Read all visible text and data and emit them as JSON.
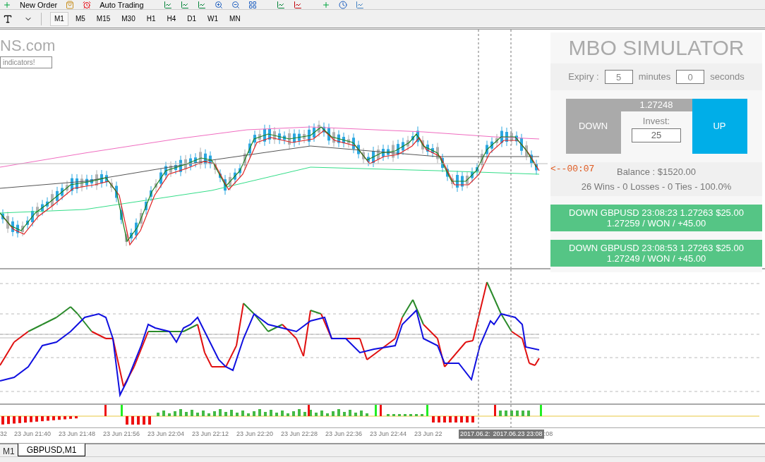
{
  "toolbar": {
    "buttons": [
      {
        "label": "New Order"
      },
      {
        "label": "Auto Trading"
      }
    ]
  },
  "timeframes": [
    {
      "label": "M1",
      "selected": true
    },
    {
      "label": "M5",
      "selected": false
    },
    {
      "label": "M15",
      "selected": false
    },
    {
      "label": "M30",
      "selected": false
    },
    {
      "label": "H1",
      "selected": false
    },
    {
      "label": "H4",
      "selected": false
    },
    {
      "label": "D1",
      "selected": false
    },
    {
      "label": "W1",
      "selected": false
    },
    {
      "label": "MN",
      "selected": false
    }
  ],
  "chart": {
    "watermark": "NS.com",
    "note": "indicators!",
    "timer": "<--00:07",
    "time_axis": [
      "32",
      "23 Jun 21:40",
      "23 Jun 21:48",
      "23 Jun 21:56",
      "23 Jun 22:04",
      "23 Jun 22:12",
      "23 Jun 22:20",
      "23 Jun 22:28",
      "23 Jun 22:36",
      "23 Jun 22:44",
      "23 Jun 22"
    ],
    "time_markers": [
      "2017.06.2:",
      "2017.06.23 23:08"
    ],
    "time_axis_tail": ":08"
  },
  "simulator": {
    "title": "MBO SIMULATOR",
    "expiry_label": "Expiry :",
    "expiry_minutes": "5",
    "minutes_label": "minutes",
    "expiry_seconds": "0",
    "seconds_label": "seconds",
    "down_label": "DOWN",
    "price": "1.27248",
    "invest_label": "Invest:",
    "invest_value": "25",
    "up_label": "UP",
    "balance": "Balance : $1520.00",
    "stats": "26 Wins - 0 Losses - 0 Ties - 100.0%",
    "trades": [
      {
        "line1": "DOWN GBPUSD 23:08:23 1.27263 $25.00",
        "line2": "1.27259 / WON / +45.00",
        "color": "#55c585"
      },
      {
        "line1": "DOWN GBPUSD 23:08:53 1.27263 $25.00",
        "line2": "1.27249 / WON / +45.00",
        "color": "#55c585"
      }
    ]
  },
  "tabs": [
    {
      "label": "M1",
      "selected": false
    },
    {
      "label": "GBPUSD,M1",
      "selected": true
    }
  ]
}
